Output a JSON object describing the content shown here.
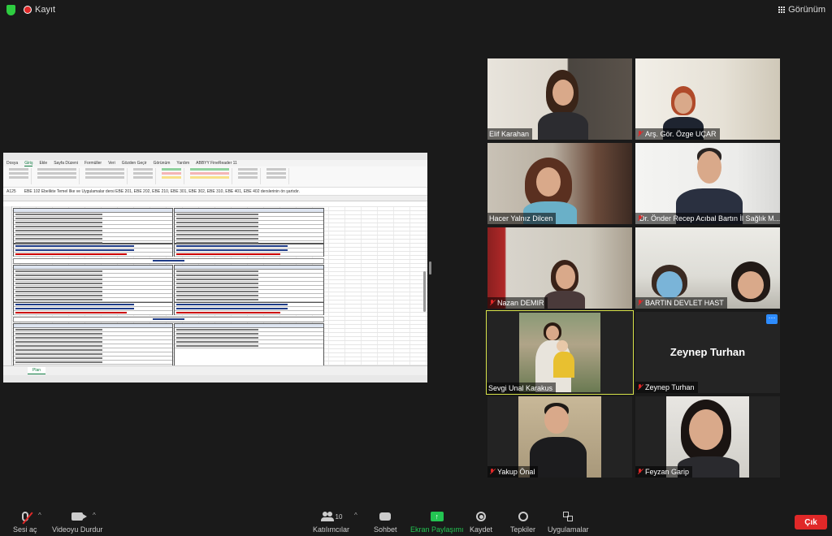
{
  "topbar": {
    "recording_label": "Kayıt",
    "view_label": "Görünüm"
  },
  "shared_screen": {
    "name_box": "A125",
    "formula_text": "EBE 102 Ebelikte Temel Ilke ve Uygulamalar dersi EBE 201, EBE 202, EBE 210, EBE 301, EBE 302, EBE 310, EBE 401, EBE 402 derslerinin ön şartıdır.",
    "menu_items": [
      "Dosya",
      "Giriş",
      "Ekle",
      "Sayfa Düzeni",
      "Formüller",
      "Veri",
      "Gözden Geçir",
      "Görünüm",
      "Yardım",
      "ABBYY FineReader 11"
    ],
    "active_menu": "Giriş",
    "sheet_tab": "Plan"
  },
  "participants": [
    {
      "name": "Elif Karahan",
      "muted": false
    },
    {
      "name": "Arş. Gör. Özge UÇAR",
      "muted": true
    },
    {
      "name": "Hacer Yalnız Dilcen",
      "muted": false
    },
    {
      "name": "Dr. Önder Recep Acıbal Bartın İl Sağlık M...",
      "muted": true
    },
    {
      "name": "Nazan DEMIR",
      "muted": true
    },
    {
      "name": "BARTIN DEVLET HAST",
      "muted": true
    },
    {
      "name": "Sevgi Unal Karakus",
      "muted": false
    },
    {
      "name": "Zeynep Turhan",
      "muted": true,
      "display_name": "Zeynep Turhan"
    },
    {
      "name": "Yakup Önal",
      "muted": true
    },
    {
      "name": "Feyzan Garip",
      "muted": true
    }
  ],
  "toolbar": {
    "mic_label": "Sesi aç",
    "video_label": "Videoyu Durdur",
    "participants_label": "Katılımcılar",
    "participants_count": "10",
    "chat_label": "Sohbet",
    "share_label": "Ekran Paylaşımı",
    "record_label": "Kaydet",
    "reactions_label": "Tepkiler",
    "apps_label": "Uygulamalar",
    "leave_label": "Çık"
  },
  "colors": {
    "active_speaker_border": "#d8e34a",
    "share_green": "#23c552",
    "leave_red": "#e02828",
    "record_red": "#e02828"
  }
}
